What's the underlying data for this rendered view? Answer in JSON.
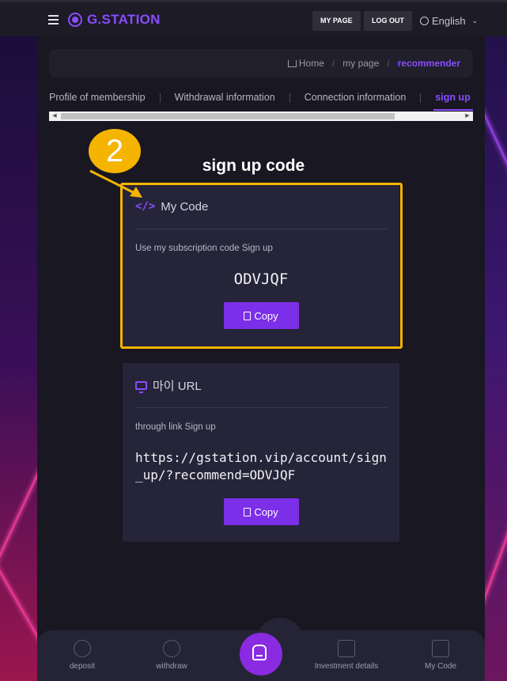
{
  "header": {
    "logo": "G.STATION",
    "my_page": "MY PAGE",
    "log_out": "LOG OUT",
    "language": "English"
  },
  "breadcrumb": {
    "home": "Home",
    "sep": "/",
    "my_page": "my page",
    "current": "recommender"
  },
  "tabs": [
    {
      "label": "Profile of membership"
    },
    {
      "label": "Withdrawal information"
    },
    {
      "label": "Connection information"
    },
    {
      "label": "sign up code"
    }
  ],
  "page_title": "sign up code",
  "my_code": {
    "title": "My Code",
    "description": "Use my subscription code Sign up",
    "code": "ODVJQF",
    "copy_label": "Copy"
  },
  "my_url": {
    "title": "마이 URL",
    "description": "through link Sign up",
    "url": "https://gstation.vip/account/sign_up/?recommend=ODVJQF",
    "copy_label": "Copy"
  },
  "annotation": {
    "step": "2"
  },
  "bottom_nav": {
    "deposit": "deposit",
    "withdraw": "withdraw",
    "investment": "Investment details",
    "my_code": "My Code"
  },
  "colors": {
    "accent": "#8a4cff",
    "highlight": "#f5b400"
  }
}
